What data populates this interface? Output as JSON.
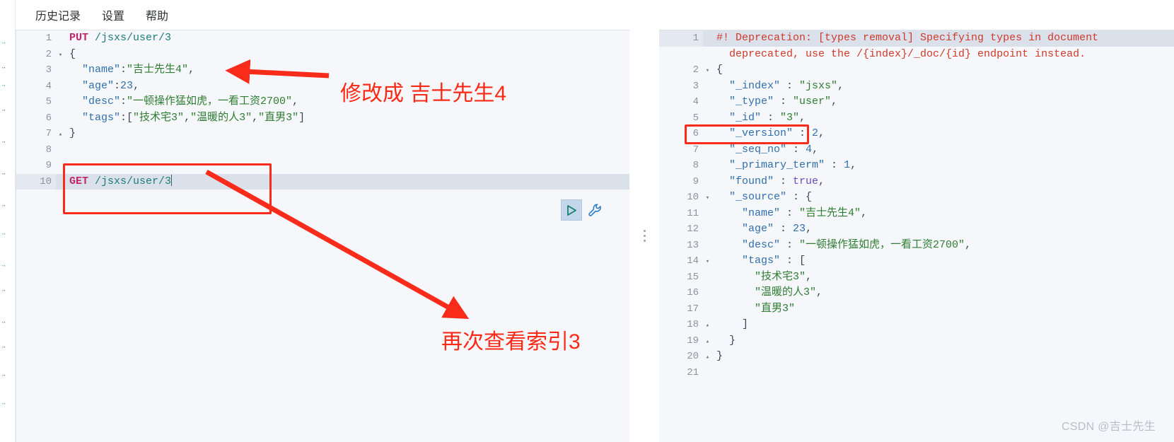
{
  "window": {
    "watermark": "CSDN @吉士先生"
  },
  "menubar": {
    "items": [
      {
        "label": "历史记录",
        "name": "menu-history"
      },
      {
        "label": "设置",
        "name": "menu-settings"
      },
      {
        "label": "帮助",
        "name": "menu-help"
      }
    ]
  },
  "left_editor": {
    "name": "request-editor",
    "run_button_title": "发送请求",
    "wrench_button_title": "工具",
    "lines": [
      {
        "no": "1",
        "fold": "",
        "tokens": [
          {
            "t": "PUT",
            "c": "t-method"
          },
          {
            "t": " ",
            "c": "t-punc"
          },
          {
            "t": "/jsxs/user/3",
            "c": "t-url"
          }
        ]
      },
      {
        "no": "2",
        "fold": "▾",
        "tokens": [
          {
            "t": "{",
            "c": "t-brace"
          }
        ]
      },
      {
        "no": "3",
        "fold": "",
        "tokens": [
          {
            "t": "  ",
            "c": "t-punc"
          },
          {
            "t": "\"name\"",
            "c": "t-key"
          },
          {
            "t": ":",
            "c": "t-punc"
          },
          {
            "t": "\"吉士先生4\"",
            "c": "t-str"
          },
          {
            "t": ",",
            "c": "t-punc"
          }
        ]
      },
      {
        "no": "4",
        "fold": "",
        "tokens": [
          {
            "t": "  ",
            "c": "t-punc"
          },
          {
            "t": "\"age\"",
            "c": "t-key"
          },
          {
            "t": ":",
            "c": "t-punc"
          },
          {
            "t": "23",
            "c": "t-num"
          },
          {
            "t": ",",
            "c": "t-punc"
          }
        ]
      },
      {
        "no": "5",
        "fold": "",
        "tokens": [
          {
            "t": "  ",
            "c": "t-punc"
          },
          {
            "t": "\"desc\"",
            "c": "t-key"
          },
          {
            "t": ":",
            "c": "t-punc"
          },
          {
            "t": "\"一顿操作猛如虎，一看工资2700\"",
            "c": "t-str"
          },
          {
            "t": ",",
            "c": "t-punc"
          }
        ]
      },
      {
        "no": "6",
        "fold": "",
        "tokens": [
          {
            "t": "  ",
            "c": "t-punc"
          },
          {
            "t": "\"tags\"",
            "c": "t-key"
          },
          {
            "t": ":[",
            "c": "t-punc"
          },
          {
            "t": "\"技术宅3\"",
            "c": "t-str"
          },
          {
            "t": ",",
            "c": "t-punc"
          },
          {
            "t": "\"温暖的人3\"",
            "c": "t-str"
          },
          {
            "t": ",",
            "c": "t-punc"
          },
          {
            "t": "\"直男3\"",
            "c": "t-str"
          },
          {
            "t": "]",
            "c": "t-punc"
          }
        ]
      },
      {
        "no": "7",
        "fold": "▴",
        "tokens": [
          {
            "t": "}",
            "c": "t-brace"
          }
        ]
      },
      {
        "no": "8",
        "fold": "",
        "tokens": []
      },
      {
        "no": "9",
        "fold": "",
        "tokens": []
      },
      {
        "no": "10",
        "fold": "",
        "highlight": true,
        "caret": true,
        "tokens": [
          {
            "t": "GET",
            "c": "t-method"
          },
          {
            "t": " ",
            "c": "t-punc"
          },
          {
            "t": "/jsxs/user/3",
            "c": "t-url"
          }
        ]
      }
    ]
  },
  "right_editor": {
    "name": "response-viewer",
    "lines": [
      {
        "no": "1",
        "fold": "",
        "highlight": true,
        "tokens": [
          {
            "t": "#! Deprecation: [types removal] Specifying types in document ",
            "c": "t-warn"
          }
        ]
      },
      {
        "no": "",
        "fold": "",
        "tokens": [
          {
            "t": "  deprecated, use the /{index}/_doc/{id} endpoint instead.",
            "c": "t-warn"
          }
        ]
      },
      {
        "no": "2",
        "fold": "▾",
        "tokens": [
          {
            "t": "{",
            "c": "t-brace"
          }
        ]
      },
      {
        "no": "3",
        "fold": "",
        "tokens": [
          {
            "t": "  ",
            "c": "t-punc"
          },
          {
            "t": "\"_index\"",
            "c": "t-key"
          },
          {
            "t": " : ",
            "c": "t-punc"
          },
          {
            "t": "\"jsxs\"",
            "c": "t-str"
          },
          {
            "t": ",",
            "c": "t-punc"
          }
        ]
      },
      {
        "no": "4",
        "fold": "",
        "tokens": [
          {
            "t": "  ",
            "c": "t-punc"
          },
          {
            "t": "\"_type\"",
            "c": "t-key"
          },
          {
            "t": " : ",
            "c": "t-punc"
          },
          {
            "t": "\"user\"",
            "c": "t-str"
          },
          {
            "t": ",",
            "c": "t-punc"
          }
        ]
      },
      {
        "no": "5",
        "fold": "",
        "tokens": [
          {
            "t": "  ",
            "c": "t-punc"
          },
          {
            "t": "\"_id\"",
            "c": "t-key"
          },
          {
            "t": " : ",
            "c": "t-punc"
          },
          {
            "t": "\"3\"",
            "c": "t-str"
          },
          {
            "t": ",",
            "c": "t-punc"
          }
        ]
      },
      {
        "no": "6",
        "fold": "",
        "tokens": [
          {
            "t": "  ",
            "c": "t-punc"
          },
          {
            "t": "\"_version\"",
            "c": "t-key"
          },
          {
            "t": " : ",
            "c": "t-punc"
          },
          {
            "t": "2",
            "c": "t-num"
          },
          {
            "t": ",",
            "c": "t-punc"
          }
        ]
      },
      {
        "no": "7",
        "fold": "",
        "tokens": [
          {
            "t": "  ",
            "c": "t-punc"
          },
          {
            "t": "\"_seq_no\"",
            "c": "t-key"
          },
          {
            "t": " : ",
            "c": "t-punc"
          },
          {
            "t": "4",
            "c": "t-num"
          },
          {
            "t": ",",
            "c": "t-punc"
          }
        ]
      },
      {
        "no": "8",
        "fold": "",
        "tokens": [
          {
            "t": "  ",
            "c": "t-punc"
          },
          {
            "t": "\"_primary_term\"",
            "c": "t-key"
          },
          {
            "t": " : ",
            "c": "t-punc"
          },
          {
            "t": "1",
            "c": "t-num"
          },
          {
            "t": ",",
            "c": "t-punc"
          }
        ]
      },
      {
        "no": "9",
        "fold": "",
        "tokens": [
          {
            "t": "  ",
            "c": "t-punc"
          },
          {
            "t": "\"found\"",
            "c": "t-key"
          },
          {
            "t": " : ",
            "c": "t-punc"
          },
          {
            "t": "true",
            "c": "t-bool"
          },
          {
            "t": ",",
            "c": "t-punc"
          }
        ]
      },
      {
        "no": "10",
        "fold": "▾",
        "tokens": [
          {
            "t": "  ",
            "c": "t-punc"
          },
          {
            "t": "\"_source\"",
            "c": "t-key"
          },
          {
            "t": " : ",
            "c": "t-punc"
          },
          {
            "t": "{",
            "c": "t-brace"
          }
        ]
      },
      {
        "no": "11",
        "fold": "",
        "tokens": [
          {
            "t": "    ",
            "c": "t-punc"
          },
          {
            "t": "\"name\"",
            "c": "t-key"
          },
          {
            "t": " : ",
            "c": "t-punc"
          },
          {
            "t": "\"吉士先生4\"",
            "c": "t-str"
          },
          {
            "t": ",",
            "c": "t-punc"
          }
        ]
      },
      {
        "no": "12",
        "fold": "",
        "tokens": [
          {
            "t": "    ",
            "c": "t-punc"
          },
          {
            "t": "\"age\"",
            "c": "t-key"
          },
          {
            "t": " : ",
            "c": "t-punc"
          },
          {
            "t": "23",
            "c": "t-num"
          },
          {
            "t": ",",
            "c": "t-punc"
          }
        ]
      },
      {
        "no": "13",
        "fold": "",
        "tokens": [
          {
            "t": "    ",
            "c": "t-punc"
          },
          {
            "t": "\"desc\"",
            "c": "t-key"
          },
          {
            "t": " : ",
            "c": "t-punc"
          },
          {
            "t": "\"一顿操作猛如虎，一看工资2700\"",
            "c": "t-str"
          },
          {
            "t": ",",
            "c": "t-punc"
          }
        ]
      },
      {
        "no": "14",
        "fold": "▾",
        "tokens": [
          {
            "t": "    ",
            "c": "t-punc"
          },
          {
            "t": "\"tags\"",
            "c": "t-key"
          },
          {
            "t": " : ",
            "c": "t-punc"
          },
          {
            "t": "[",
            "c": "t-punc"
          }
        ]
      },
      {
        "no": "15",
        "fold": "",
        "tokens": [
          {
            "t": "      ",
            "c": "t-punc"
          },
          {
            "t": "\"技术宅3\"",
            "c": "t-str"
          },
          {
            "t": ",",
            "c": "t-punc"
          }
        ]
      },
      {
        "no": "16",
        "fold": "",
        "tokens": [
          {
            "t": "      ",
            "c": "t-punc"
          },
          {
            "t": "\"温暖的人3\"",
            "c": "t-str"
          },
          {
            "t": ",",
            "c": "t-punc"
          }
        ]
      },
      {
        "no": "17",
        "fold": "",
        "tokens": [
          {
            "t": "      ",
            "c": "t-punc"
          },
          {
            "t": "\"直男3\"",
            "c": "t-str"
          }
        ]
      },
      {
        "no": "18",
        "fold": "▴",
        "tokens": [
          {
            "t": "    ",
            "c": "t-punc"
          },
          {
            "t": "]",
            "c": "t-punc"
          }
        ]
      },
      {
        "no": "19",
        "fold": "▴",
        "tokens": [
          {
            "t": "  ",
            "c": "t-punc"
          },
          {
            "t": "}",
            "c": "t-brace"
          }
        ]
      },
      {
        "no": "20",
        "fold": "▴",
        "tokens": [
          {
            "t": "}",
            "c": "t-brace"
          }
        ]
      },
      {
        "no": "21",
        "fold": "",
        "tokens": []
      }
    ]
  },
  "annotations": {
    "color": "#f92c1c",
    "note_modify": "修改成 吉士先生4",
    "note_query": "再次查看索引3"
  }
}
